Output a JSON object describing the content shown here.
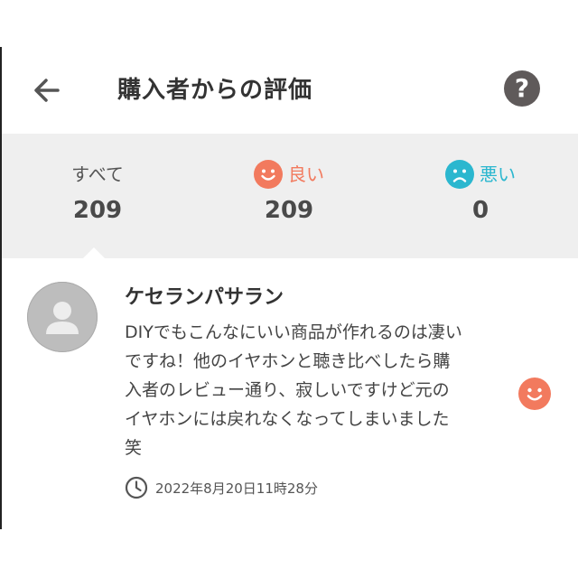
{
  "header": {
    "title": "購入者からの評価"
  },
  "tabs": [
    {
      "label": "すべて",
      "count": "209",
      "color": "#555555"
    },
    {
      "label": "良い",
      "count": "209",
      "color": "#f27a5e",
      "icon": "smile-face-icon"
    },
    {
      "label": "悪い",
      "count": "0",
      "color": "#2bb7cf",
      "icon": "sad-face-icon"
    }
  ],
  "review": {
    "reviewer_name": "ケセランパサラン",
    "lines": [
      "DIYでもこんなにいい商品が作れるのは凄い",
      "ですね！他のイヤホンと聴き比べしたら購",
      "入者のレビュー通り、寂しいですけど元の",
      "イヤホンには戻れなくなってしまいました",
      "笑"
    ],
    "timestamp": "2022年8月20日11時28分",
    "rating_icon": "smile-face-icon"
  },
  "colors": {
    "good": "#f27a5e",
    "bad": "#2bb7cf",
    "tab_bg": "#efefef",
    "help_bg": "#5f5a5a"
  }
}
